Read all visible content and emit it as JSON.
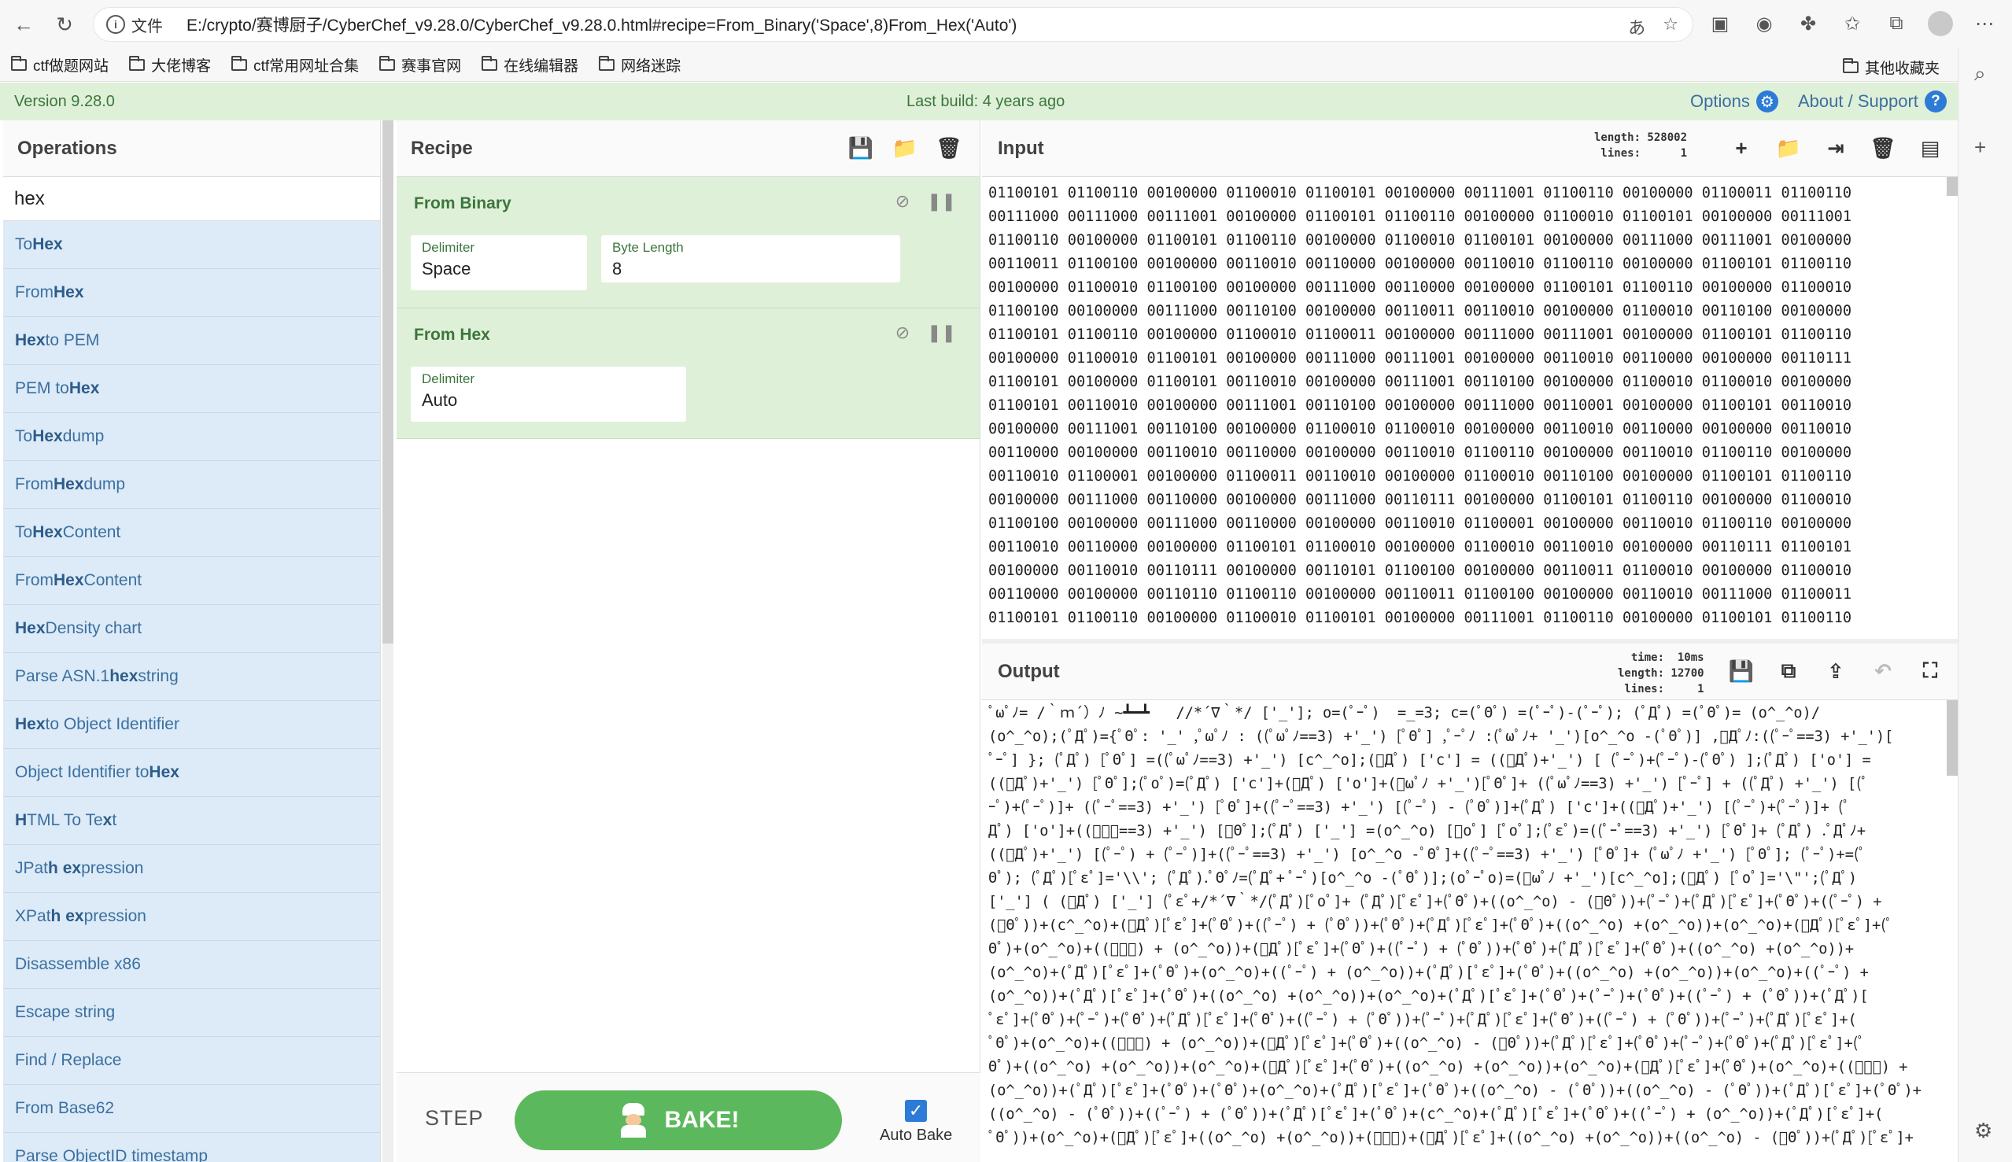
{
  "browser": {
    "addr_label": "文件",
    "url": "E:/crypto/赛博厨子/CyberChef_v9.28.0/CyberChef_v9.28.0.html#recipe=From_Binary('Space',8)From_Hex('Auto')",
    "bookmarks": [
      "ctf做题网站",
      "大佬博客",
      "ctf常用网址合集",
      "赛事官网",
      "在线编辑器",
      "网络迷踪"
    ],
    "other_bookmarks": "其他收藏夹"
  },
  "banner": {
    "version": "Version 9.28.0",
    "last_build": "Last build: 4 years ago",
    "options": "Options",
    "about": "About / Support"
  },
  "operations": {
    "title": "Operations",
    "search_value": "hex",
    "items": [
      {
        "pre": "To ",
        "hl": "Hex",
        "post": ""
      },
      {
        "pre": "From ",
        "hl": "Hex",
        "post": ""
      },
      {
        "pre": "",
        "hl": "Hex",
        "post": " to PEM"
      },
      {
        "pre": "PEM to ",
        "hl": "Hex",
        "post": ""
      },
      {
        "pre": "To ",
        "hl": "Hex",
        "post": "dump"
      },
      {
        "pre": "From ",
        "hl": "Hex",
        "post": "dump"
      },
      {
        "pre": "To ",
        "hl": "Hex",
        "post": " Content"
      },
      {
        "pre": "From ",
        "hl": "Hex",
        "post": " Content"
      },
      {
        "pre": "",
        "hl": "Hex",
        "post": " Density chart"
      },
      {
        "pre": "Parse ASN.1 ",
        "hl": "hex",
        "post": " string"
      },
      {
        "pre": "",
        "hl": "Hex",
        "post": " to Object Identifier"
      },
      {
        "pre": "Object Identifier to ",
        "hl": "Hex",
        "post": ""
      },
      {
        "pre": "",
        "hl": "H",
        "post": "TML To Te",
        "hl2": "x",
        "post2": "t"
      },
      {
        "pre": "JPat",
        "hl": "h ex",
        "post": "pression"
      },
      {
        "pre": "XPat",
        "hl": "h ex",
        "post": "pression"
      },
      {
        "pre": "Disassemble x86",
        "hl": "",
        "post": ""
      },
      {
        "pre": "Escape string",
        "hl": "",
        "post": ""
      },
      {
        "pre": "Find / Replace",
        "hl": "",
        "post": ""
      },
      {
        "pre": "From Base62",
        "hl": "",
        "post": ""
      },
      {
        "pre": "Parse ObjectID timestamp",
        "hl": "",
        "post": ""
      }
    ]
  },
  "recipe": {
    "title": "Recipe",
    "from_binary": {
      "title": "From Binary",
      "delimiter_label": "Delimiter",
      "delimiter_value": "Space",
      "bytelen_label": "Byte Length",
      "bytelen_value": "8"
    },
    "from_hex": {
      "title": "From Hex",
      "delimiter_label": "Delimiter",
      "delimiter_value": "Auto"
    },
    "step_label": "STEP",
    "bake_label": "BAKE!",
    "autobake_label": "Auto Bake"
  },
  "input": {
    "title": "Input",
    "meta": "length: 528002\n lines:      1",
    "lines": [
      "01100101 01100110 00100000 01100010 01100101 00100000 00111001 01100110 00100000 01100011 01100110",
      "00111000 00111000 00111001 00100000 01100101 01100110 00100000 01100010 01100101 00100000 00111001",
      "01100110 00100000 01100101 01100110 00100000 01100010 01100101 00100000 00111000 00111001 00100000",
      "00110011 01100100 00100000 00110010 00110000 00100000 00110010 01100110 00100000 01100101 01100110",
      "00100000 01100010 01100100 00100000 00111000 00110000 00100000 01100101 01100110 00100000 01100010",
      "01100100 00100000 00111000 00110100 00100000 00110011 00110010 00100000 01100010 00110100 00100000",
      "01100101 01100110 00100000 01100010 01100011 00100000 00111000 00111001 00100000 01100101 01100110",
      "00100000 01100010 01100101 00100000 00111000 00111001 00100000 00110010 00110000 00100000 00110111",
      "01100101 00100000 01100101 00110010 00100000 00111001 00110100 00100000 01100010 01100010 00100000",
      "01100101 00110010 00100000 00111001 00110100 00100000 00111000 00110001 00100000 01100101 00110010",
      "00100000 00111001 00110100 00100000 01100010 01100010 00100000 00110010 00110000 00100000 00110010",
      "00110000 00100000 00110010 00110000 00100000 00110010 01100110 00100000 00110010 01100110 00100000",
      "00110010 01100001 00100000 01100011 00110010 00100000 01100010 00110100 00100000 01100101 01100110",
      "00100000 00111000 00110000 00100000 00111000 00110111 00100000 01100101 01100110 00100000 01100010",
      "01100100 00100000 00111000 00110000 00100000 00110010 01100001 00100000 00110010 01100110 00100000",
      "00110010 00110000 00100000 01100101 01100010 00100000 01100010 00110010 00100000 00110111 01100101",
      "00100000 00110010 00110111 00100000 00110101 01100100 00100000 00110011 01100010 00100000 01100010",
      "00110000 00100000 00110110 01100110 00100000 00110011 01100100 00100000 00110010 00111000 01100011",
      "01100101 01100110 00100000 01100010 01100101 00100000 00111001 01100110 00100000 01100101 01100110"
    ]
  },
  "output": {
    "title": "Output",
    "meta": "  time:  10ms\nlength: 12700\n lines:     1",
    "lines": [
      "ﾟωﾟﾉ= /｀ｍ´）ﾉ ~┻━┻   //*´∇｀*/ ['_']; o=(ﾟｰﾟ)  =_=3; c=(ﾟΘﾟ) =(ﾟｰﾟ)-(ﾟｰﾟ); (ﾟДﾟ) =(ﾟΘﾟ)= (o^_^o)/",
      "(o^_^o);(ﾟДﾟ)={ﾟΘﾟ: '_' ,ﾟωﾟﾉ : ((ﾟωﾟﾉ==3) +'_') [ﾟΘﾟ] ,ﾟｰﾟﾉ :(ﾟωﾟﾉ+ '_')[o^_^o -(ﾟΘﾟ)] ,ﾟДﾟﾉ:((ﾟｰﾟ==3) +'_')[",
      "ﾟｰﾟ] }; (ﾟДﾟ) [ﾟΘﾟ] =((ﾟωﾟﾉ==3) +'_') [c^_^o];(ﾟДﾟ) ['c'] = ((ﾟДﾟ)+'_') [ (ﾟｰﾟ)+(ﾟｰﾟ)-(ﾟΘﾟ) ];(ﾟДﾟ) ['o'] =",
      "((ﾟДﾟ)+'_') [ﾟΘﾟ];(ﾟoﾟ)=(ﾟДﾟ) ['c']+(ﾟДﾟ) ['o']+(ﾟωﾟﾉ +'_')[ﾟΘﾟ]+ ((ﾟωﾟﾉ==3) +'_') [ﾟｰﾟ] + ((ﾟДﾟ) +'_') [(ﾟ",
      "ｰﾟ)+(ﾟｰﾟ)]+ ((ﾟｰﾟ==3) +'_') [ﾟΘﾟ]+((ﾟｰﾟ==3) +'_') [(ﾟｰﾟ) - (ﾟΘﾟ)]+(ﾟДﾟ) ['c']+((ﾟДﾟ)+'_') [(ﾟｰﾟ)+(ﾟｰﾟ)]+ (ﾟ",
      "Дﾟ) ['o']+((ﾟｰﾟ==3) +'_') [ﾟΘﾟ];(ﾟДﾟ) ['_'] =(o^_^o) [ﾟoﾟ] [ﾟoﾟ];(ﾟεﾟ)=((ﾟｰﾟ==3) +'_') [ﾟΘﾟ]+ (ﾟДﾟ) .ﾟДﾟﾉ+",
      "((ﾟДﾟ)+'_') [(ﾟｰﾟ) + (ﾟｰﾟ)]+((ﾟｰﾟ==3) +'_') [o^_^o -ﾟΘﾟ]+((ﾟｰﾟ==3) +'_') [ﾟΘﾟ]+ (ﾟωﾟﾉ +'_') [ﾟΘﾟ]; (ﾟｰﾟ)+=(ﾟ",
      "Θﾟ); (ﾟДﾟ)[ﾟεﾟ]='\\\\'; (ﾟДﾟ).ﾟΘﾟﾉ=(ﾟДﾟ+ ﾟｰﾟ)[o^_^o -(ﾟΘﾟ)];(oﾟｰﾟo)=(ﾟωﾟﾉ +'_')[c^_^o];(ﾟДﾟ) [ﾟoﾟ]='\\\"';(ﾟДﾟ)",
      "['_'] ( (ﾟДﾟ) ['_'] (ﾟεﾟ+/*´∇｀*/(ﾟДﾟ)[ﾟoﾟ]+ (ﾟДﾟ)[ﾟεﾟ]+(ﾟΘﾟ)+((o^_^o) - (ﾟΘﾟ))+(ﾟｰﾟ)+(ﾟДﾟ)[ﾟεﾟ]+(ﾟΘﾟ)+((ﾟｰﾟ) +",
      "(ﾟΘﾟ))+(c^_^o)+(ﾟДﾟ)[ﾟεﾟ]+(ﾟΘﾟ)+((ﾟｰﾟ) + (ﾟΘﾟ))+(ﾟΘﾟ)+(ﾟДﾟ)[ﾟεﾟ]+(ﾟΘﾟ)+((o^_^o) +(o^_^o))+(o^_^o)+(ﾟДﾟ)[ﾟεﾟ]+(ﾟ",
      "Θﾟ)+(o^_^o)+((ﾟｰﾟ) + (o^_^o))+(ﾟДﾟ)[ﾟεﾟ]+(ﾟΘﾟ)+((ﾟｰﾟ) + (ﾟΘﾟ))+(ﾟΘﾟ)+(ﾟДﾟ)[ﾟεﾟ]+(ﾟΘﾟ)+((o^_^o) +(o^_^o))+",
      "(o^_^o)+(ﾟДﾟ)[ﾟεﾟ]+(ﾟΘﾟ)+(o^_^o)+((ﾟｰﾟ) + (o^_^o))+(ﾟДﾟ)[ﾟεﾟ]+(ﾟΘﾟ)+((o^_^o) +(o^_^o))+(o^_^o)+((ﾟｰﾟ) +",
      "(o^_^o))+(ﾟДﾟ)[ﾟεﾟ]+(ﾟΘﾟ)+((o^_^o) +(o^_^o))+(o^_^o)+(ﾟДﾟ)[ﾟεﾟ]+(ﾟΘﾟ)+(ﾟｰﾟ)+(ﾟΘﾟ)+((ﾟｰﾟ) + (ﾟΘﾟ))+(ﾟДﾟ)[",
      "ﾟεﾟ]+(ﾟΘﾟ)+(ﾟｰﾟ)+(ﾟΘﾟ)+(ﾟДﾟ)[ﾟεﾟ]+(ﾟΘﾟ)+((ﾟｰﾟ) + (ﾟΘﾟ))+(ﾟｰﾟ)+(ﾟДﾟ)[ﾟεﾟ]+(ﾟΘﾟ)+((ﾟｰﾟ) + (ﾟΘﾟ))+(ﾟｰﾟ)+(ﾟДﾟ)[ﾟεﾟ]+(",
      "ﾟΘﾟ)+(o^_^o)+((ﾟｰﾟ) + (o^_^o))+(ﾟДﾟ)[ﾟεﾟ]+(ﾟΘﾟ)+((o^_^o) - (ﾟΘﾟ))+(ﾟДﾟ)[ﾟεﾟ]+(ﾟΘﾟ)+(ﾟｰﾟ)+(ﾟΘﾟ)+(ﾟДﾟ)[ﾟεﾟ]+(ﾟ",
      "Θﾟ)+((o^_^o) +(o^_^o))+(o^_^o)+(ﾟДﾟ)[ﾟεﾟ]+(ﾟΘﾟ)+((o^_^o) +(o^_^o))+(o^_^o)+(ﾟДﾟ)[ﾟεﾟ]+(ﾟΘﾟ)+(o^_^o)+((ﾟｰﾟ) +",
      "(o^_^o))+(ﾟДﾟ)[ﾟεﾟ]+(ﾟΘﾟ)+(ﾟΘﾟ)+(o^_^o)+(ﾟДﾟ)[ﾟεﾟ]+(ﾟΘﾟ)+((o^_^o) - (ﾟΘﾟ))+((o^_^o) - (ﾟΘﾟ))+(ﾟДﾟ)[ﾟεﾟ]+(ﾟΘﾟ)+",
      "((o^_^o) - (ﾟΘﾟ))+((ﾟｰﾟ) + (ﾟΘﾟ))+(ﾟДﾟ)[ﾟεﾟ]+(ﾟΘﾟ)+(c^_^o)+(ﾟДﾟ)[ﾟεﾟ]+(ﾟΘﾟ)+((ﾟｰﾟ) + (o^_^o))+(ﾟДﾟ)[ﾟεﾟ]+(",
      "ﾟΘﾟ))+(o^_^o)+(ﾟДﾟ)[ﾟεﾟ]+((o^_^o) +(o^_^o))+(ﾟｰﾟ)+(ﾟДﾟ)[ﾟεﾟ]+((o^_^o) +(o^_^o))+((o^_^o) - (ﾟΘﾟ))+(ﾟДﾟ)[ﾟεﾟ]+"
    ]
  }
}
